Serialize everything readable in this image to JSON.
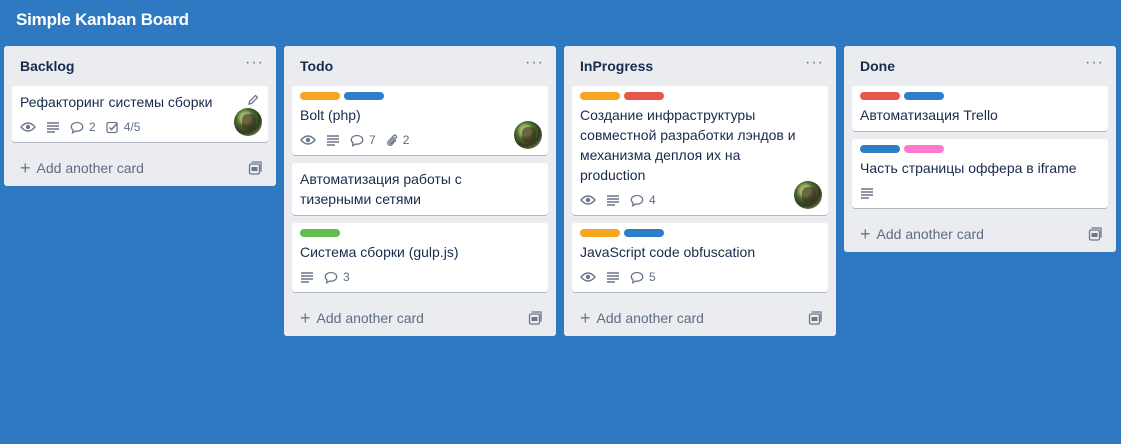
{
  "board": {
    "title": "Simple Kanban Board"
  },
  "colors": {
    "background": "#2f79c3",
    "orange": "#f6a623",
    "blue": "#2d7fc7",
    "red": "#e8574a",
    "green": "#61bd4f",
    "pink": "#ff78cb"
  },
  "lists": [
    {
      "title": "Backlog",
      "menu": "···",
      "add_label": "Add another card",
      "cards": [
        {
          "title": "Рефакторинг системы сборки",
          "watch": true,
          "description": true,
          "comments": "2",
          "checklist": "4/5",
          "avatar": true,
          "edit": true
        }
      ]
    },
    {
      "title": "Todo",
      "menu": "···",
      "add_label": "Add another card",
      "cards": [
        {
          "labels": [
            "orange",
            "blue"
          ],
          "title": "Bolt (php)",
          "watch": true,
          "description": true,
          "comments": "7",
          "attachments": "2",
          "avatar": true
        },
        {
          "title": "Автоматизация работы с тизерными сетями"
        },
        {
          "labels": [
            "green"
          ],
          "title": "Система сборки (gulp.js)",
          "description": true,
          "comments": "3"
        }
      ]
    },
    {
      "title": "InProgress",
      "menu": "···",
      "add_label": "Add another card",
      "cards": [
        {
          "labels": [
            "orange",
            "red"
          ],
          "title": "Создание инфраструктуры совместной разработки лэндов и механизма деплоя их на production",
          "watch": true,
          "description": true,
          "comments": "4",
          "avatar": true
        },
        {
          "labels": [
            "orange",
            "blue"
          ],
          "title": "JavaScript code obfuscation",
          "watch": true,
          "description": true,
          "comments": "5"
        }
      ]
    },
    {
      "title": "Done",
      "menu": "···",
      "add_label": "Add another card",
      "cards": [
        {
          "labels": [
            "red",
            "blue"
          ],
          "title": "Автоматизация Trello"
        },
        {
          "labels": [
            "blue",
            "pink"
          ],
          "title": "Часть страницы оффера в iframe",
          "description": true
        }
      ]
    }
  ]
}
